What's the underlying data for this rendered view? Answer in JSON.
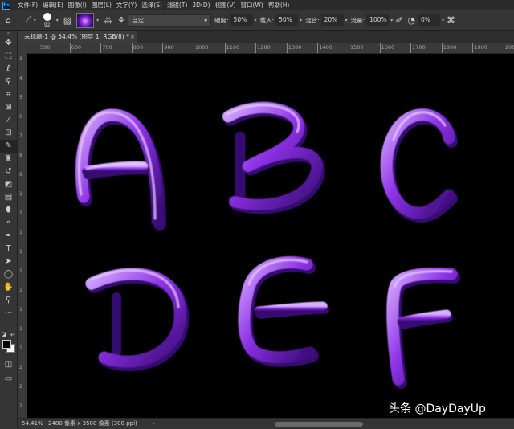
{
  "menubar": {
    "items": [
      "文件(F)",
      "编辑(E)",
      "图像(I)",
      "图层(L)",
      "文字(Y)",
      "选择(S)",
      "滤镜(T)",
      "3D(D)",
      "视图(V)",
      "窗口(W)",
      "帮助(H)"
    ]
  },
  "options": {
    "brush_size": "92",
    "preset": "自定",
    "feather_label": "硬度:",
    "feather_value": "50%",
    "load_label": "载入:",
    "load_value": "50%",
    "mix_label": "混合:",
    "mix_value": "20%",
    "flow_label": "流量:",
    "flow_value": "100%",
    "angle_value": "0%"
  },
  "document": {
    "tab_title": "未标题-1 @ 54.4% (图层 1, RGB/8) *"
  },
  "ruler_top_labels": [
    "500",
    "600",
    "700",
    "800",
    "900",
    "1000",
    "1100",
    "1200",
    "1300",
    "1400",
    "1500",
    "1600",
    "1700",
    "1800",
    "1900",
    "2000"
  ],
  "ruler_left_labels": [
    "3",
    "4",
    "5",
    "6",
    "7",
    "8",
    "9",
    "1",
    "1",
    "1",
    "1",
    "1",
    "1",
    "1",
    "1",
    "1",
    "2",
    "2",
    "2"
  ],
  "canvas": {
    "letters": [
      "A",
      "B",
      "C",
      "D",
      "E",
      "F"
    ]
  },
  "status": {
    "zoom": "54.41%",
    "doc_info": "2480 像素 x 3508 像素 (300 ppi)"
  },
  "watermark": "头条 @DayDayUp",
  "colors": {
    "stroke_light": "#c89cff",
    "stroke_main": "#8a2be2",
    "stroke_dark": "#3b0a7a"
  }
}
